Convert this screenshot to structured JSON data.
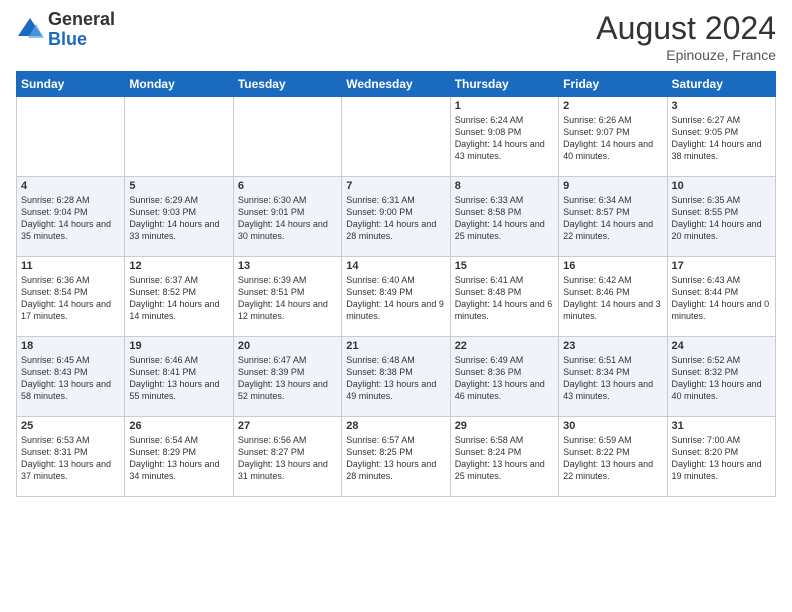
{
  "logo": {
    "general": "General",
    "blue": "Blue"
  },
  "title": "August 2024",
  "subtitle": "Epinouze, France",
  "days_of_week": [
    "Sunday",
    "Monday",
    "Tuesday",
    "Wednesday",
    "Thursday",
    "Friday",
    "Saturday"
  ],
  "weeks": [
    [
      {
        "day": "",
        "info": ""
      },
      {
        "day": "",
        "info": ""
      },
      {
        "day": "",
        "info": ""
      },
      {
        "day": "",
        "info": ""
      },
      {
        "day": "1",
        "info": "Sunrise: 6:24 AM\nSunset: 9:08 PM\nDaylight: 14 hours and 43 minutes."
      },
      {
        "day": "2",
        "info": "Sunrise: 6:26 AM\nSunset: 9:07 PM\nDaylight: 14 hours and 40 minutes."
      },
      {
        "day": "3",
        "info": "Sunrise: 6:27 AM\nSunset: 9:05 PM\nDaylight: 14 hours and 38 minutes."
      }
    ],
    [
      {
        "day": "4",
        "info": "Sunrise: 6:28 AM\nSunset: 9:04 PM\nDaylight: 14 hours and 35 minutes."
      },
      {
        "day": "5",
        "info": "Sunrise: 6:29 AM\nSunset: 9:03 PM\nDaylight: 14 hours and 33 minutes."
      },
      {
        "day": "6",
        "info": "Sunrise: 6:30 AM\nSunset: 9:01 PM\nDaylight: 14 hours and 30 minutes."
      },
      {
        "day": "7",
        "info": "Sunrise: 6:31 AM\nSunset: 9:00 PM\nDaylight: 14 hours and 28 minutes."
      },
      {
        "day": "8",
        "info": "Sunrise: 6:33 AM\nSunset: 8:58 PM\nDaylight: 14 hours and 25 minutes."
      },
      {
        "day": "9",
        "info": "Sunrise: 6:34 AM\nSunset: 8:57 PM\nDaylight: 14 hours and 22 minutes."
      },
      {
        "day": "10",
        "info": "Sunrise: 6:35 AM\nSunset: 8:55 PM\nDaylight: 14 hours and 20 minutes."
      }
    ],
    [
      {
        "day": "11",
        "info": "Sunrise: 6:36 AM\nSunset: 8:54 PM\nDaylight: 14 hours and 17 minutes."
      },
      {
        "day": "12",
        "info": "Sunrise: 6:37 AM\nSunset: 8:52 PM\nDaylight: 14 hours and 14 minutes."
      },
      {
        "day": "13",
        "info": "Sunrise: 6:39 AM\nSunset: 8:51 PM\nDaylight: 14 hours and 12 minutes."
      },
      {
        "day": "14",
        "info": "Sunrise: 6:40 AM\nSunset: 8:49 PM\nDaylight: 14 hours and 9 minutes."
      },
      {
        "day": "15",
        "info": "Sunrise: 6:41 AM\nSunset: 8:48 PM\nDaylight: 14 hours and 6 minutes."
      },
      {
        "day": "16",
        "info": "Sunrise: 6:42 AM\nSunset: 8:46 PM\nDaylight: 14 hours and 3 minutes."
      },
      {
        "day": "17",
        "info": "Sunrise: 6:43 AM\nSunset: 8:44 PM\nDaylight: 14 hours and 0 minutes."
      }
    ],
    [
      {
        "day": "18",
        "info": "Sunrise: 6:45 AM\nSunset: 8:43 PM\nDaylight: 13 hours and 58 minutes."
      },
      {
        "day": "19",
        "info": "Sunrise: 6:46 AM\nSunset: 8:41 PM\nDaylight: 13 hours and 55 minutes."
      },
      {
        "day": "20",
        "info": "Sunrise: 6:47 AM\nSunset: 8:39 PM\nDaylight: 13 hours and 52 minutes."
      },
      {
        "day": "21",
        "info": "Sunrise: 6:48 AM\nSunset: 8:38 PM\nDaylight: 13 hours and 49 minutes."
      },
      {
        "day": "22",
        "info": "Sunrise: 6:49 AM\nSunset: 8:36 PM\nDaylight: 13 hours and 46 minutes."
      },
      {
        "day": "23",
        "info": "Sunrise: 6:51 AM\nSunset: 8:34 PM\nDaylight: 13 hours and 43 minutes."
      },
      {
        "day": "24",
        "info": "Sunrise: 6:52 AM\nSunset: 8:32 PM\nDaylight: 13 hours and 40 minutes."
      }
    ],
    [
      {
        "day": "25",
        "info": "Sunrise: 6:53 AM\nSunset: 8:31 PM\nDaylight: 13 hours and 37 minutes."
      },
      {
        "day": "26",
        "info": "Sunrise: 6:54 AM\nSunset: 8:29 PM\nDaylight: 13 hours and 34 minutes."
      },
      {
        "day": "27",
        "info": "Sunrise: 6:56 AM\nSunset: 8:27 PM\nDaylight: 13 hours and 31 minutes."
      },
      {
        "day": "28",
        "info": "Sunrise: 6:57 AM\nSunset: 8:25 PM\nDaylight: 13 hours and 28 minutes."
      },
      {
        "day": "29",
        "info": "Sunrise: 6:58 AM\nSunset: 8:24 PM\nDaylight: 13 hours and 25 minutes."
      },
      {
        "day": "30",
        "info": "Sunrise: 6:59 AM\nSunset: 8:22 PM\nDaylight: 13 hours and 22 minutes."
      },
      {
        "day": "31",
        "info": "Sunrise: 7:00 AM\nSunset: 8:20 PM\nDaylight: 13 hours and 19 minutes."
      }
    ]
  ]
}
